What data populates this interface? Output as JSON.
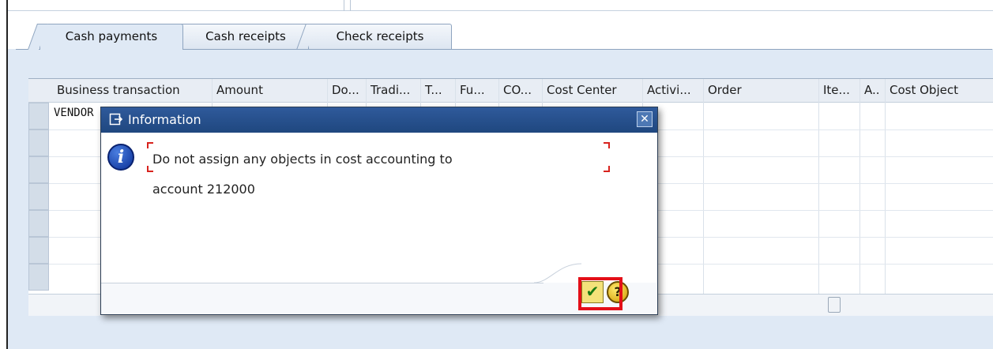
{
  "tabs": [
    {
      "label": "Cash payments",
      "active": true
    },
    {
      "label": "Cash receipts",
      "active": false
    },
    {
      "label": "Check receipts",
      "active": false
    }
  ],
  "table": {
    "columns": [
      "Business transaction",
      "Amount",
      "Do...",
      "Tradi...",
      "T...",
      "Fu...",
      "CO...",
      "Cost Center",
      "Activi...",
      "Order",
      "Ite...",
      "A..",
      "Cost Object"
    ],
    "first_row_value": "VENDOR"
  },
  "dialog": {
    "title": "Information",
    "message_line1": "Do not assign any objects in cost accounting to",
    "message_line2": "account 212000",
    "ok_icon": "checkmark-icon",
    "help_icon": "help-icon",
    "close_icon": "close-icon",
    "highlight_color": "#e40f18"
  }
}
